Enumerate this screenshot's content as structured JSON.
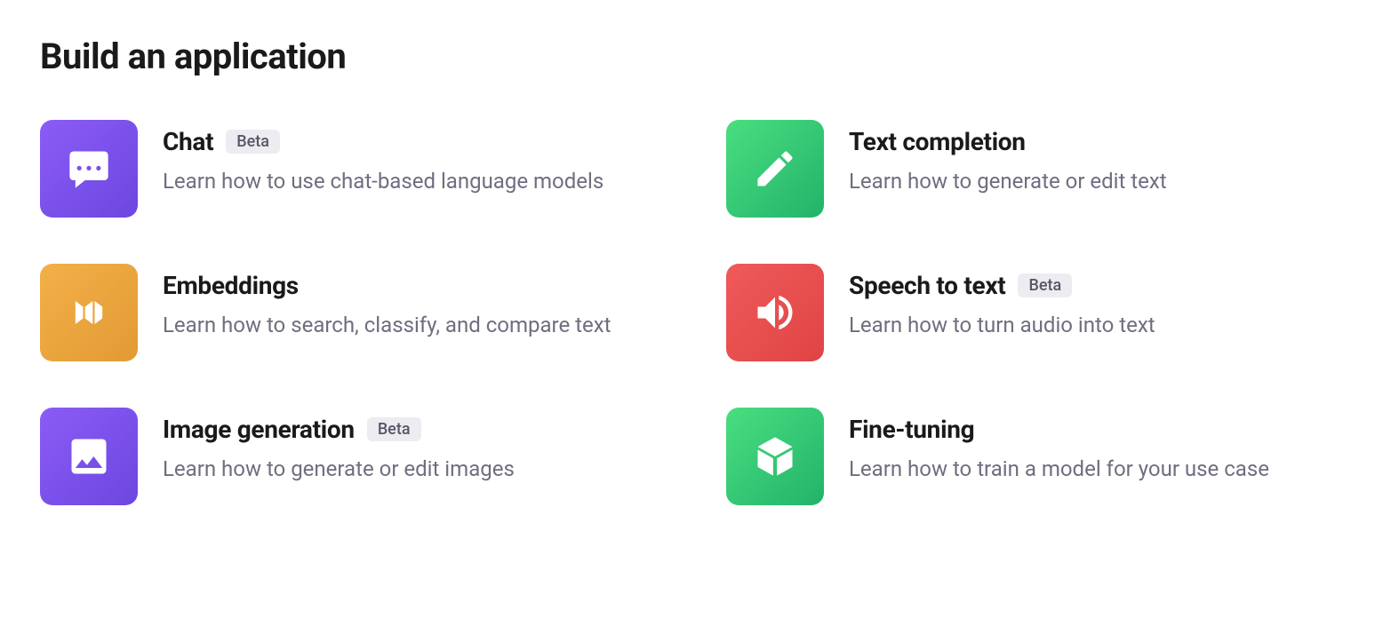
{
  "title": "Build an application",
  "badge_label": "Beta",
  "cards": {
    "chat": {
      "title": "Chat",
      "desc": "Learn how to use chat-based language models",
      "has_badge": true
    },
    "text_completion": {
      "title": "Text completion",
      "desc": "Learn how to generate or edit text",
      "has_badge": false
    },
    "embeddings": {
      "title": "Embeddings",
      "desc": "Learn how to search, classify, and compare text",
      "has_badge": false
    },
    "speech_to_text": {
      "title": "Speech to text",
      "desc": "Learn how to turn audio into text",
      "has_badge": true
    },
    "image_generation": {
      "title": "Image generation",
      "desc": "Learn how to generate or edit images",
      "has_badge": true
    },
    "fine_tuning": {
      "title": "Fine-tuning",
      "desc": "Learn how to train a model for your use case",
      "has_badge": false
    }
  }
}
